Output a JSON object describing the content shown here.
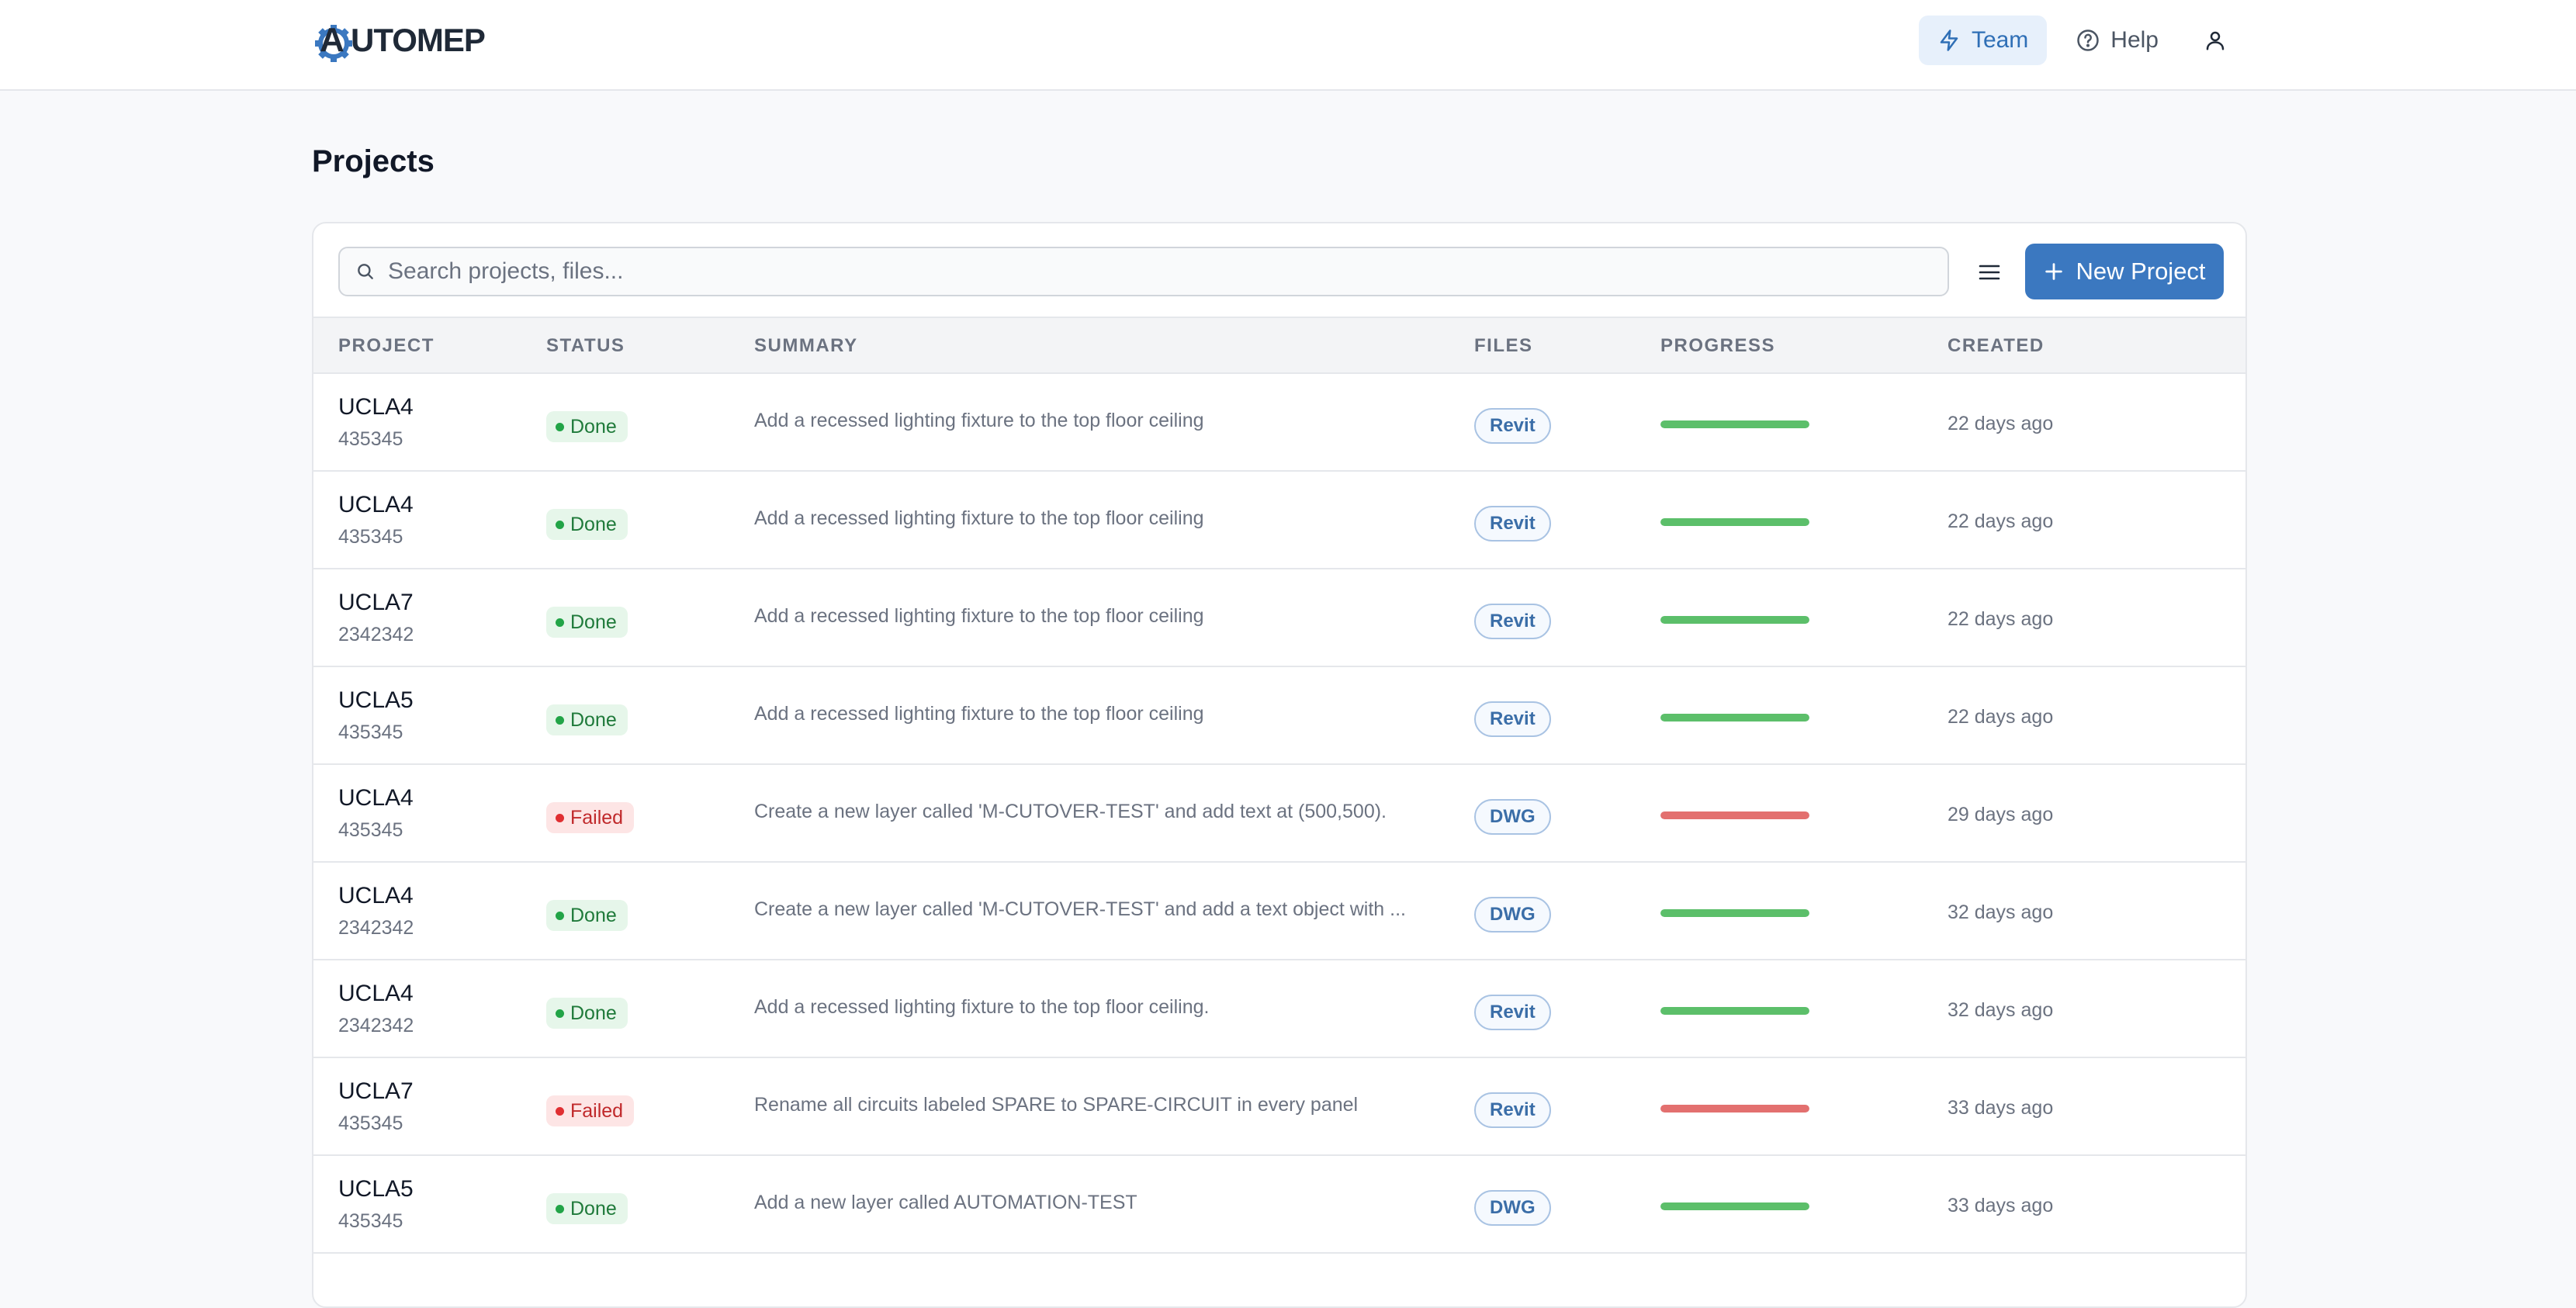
{
  "brand": {
    "name": "UTOMEP",
    "initial": "A"
  },
  "nav": {
    "team_label": "Team",
    "help_label": "Help"
  },
  "page": {
    "title": "Projects"
  },
  "toolbar": {
    "search_placeholder": "Search projects, files...",
    "new_project_label": "New Project"
  },
  "table": {
    "columns": [
      "PROJECT",
      "STATUS",
      "SUMMARY",
      "FILES",
      "PROGRESS",
      "CREATED"
    ],
    "rows": [
      {
        "project": "UCLA4",
        "id": "435345",
        "status": "Done",
        "status_kind": "done",
        "summary": "Add a recessed lighting fixture to the top floor ceiling",
        "file": "Revit",
        "progress": 1.0,
        "created": "22 days ago"
      },
      {
        "project": "UCLA4",
        "id": "435345",
        "status": "Done",
        "status_kind": "done",
        "summary": "Add a recessed lighting fixture to the top floor ceiling",
        "file": "Revit",
        "progress": 1.0,
        "created": "22 days ago"
      },
      {
        "project": "UCLA7",
        "id": "2342342",
        "status": "Done",
        "status_kind": "done",
        "summary": "Add a recessed lighting fixture to the top floor ceiling",
        "file": "Revit",
        "progress": 1.0,
        "created": "22 days ago"
      },
      {
        "project": "UCLA5",
        "id": "435345",
        "status": "Done",
        "status_kind": "done",
        "summary": "Add a recessed lighting fixture to the top floor ceiling",
        "file": "Revit",
        "progress": 1.0,
        "created": "22 days ago"
      },
      {
        "project": "UCLA4",
        "id": "435345",
        "status": "Failed",
        "status_kind": "failed",
        "summary": "Create a new layer called 'M-CUTOVER-TEST' and add text at (500,500).",
        "file": "DWG",
        "progress": 1.0,
        "created": "29 days ago"
      },
      {
        "project": "UCLA4",
        "id": "2342342",
        "status": "Done",
        "status_kind": "done",
        "summary": "Create a new layer called 'M-CUTOVER-TEST' and add a text object with ...",
        "file": "DWG",
        "progress": 1.0,
        "created": "32 days ago"
      },
      {
        "project": "UCLA4",
        "id": "2342342",
        "status": "Done",
        "status_kind": "done",
        "summary": "Add a recessed lighting fixture to the top floor ceiling.",
        "file": "Revit",
        "progress": 1.0,
        "created": "32 days ago"
      },
      {
        "project": "UCLA7",
        "id": "435345",
        "status": "Failed",
        "status_kind": "failed",
        "summary": "Rename all circuits labeled SPARE to SPARE-CIRCUIT in every panel",
        "file": "Revit",
        "progress": 1.0,
        "created": "33 days ago"
      },
      {
        "project": "UCLA5",
        "id": "435345",
        "status": "Done",
        "status_kind": "done",
        "summary": "Add a new layer called AUTOMATION-TEST",
        "file": "DWG",
        "progress": 1.0,
        "created": "33 days ago"
      }
    ]
  },
  "colors": {
    "accent": "#3b78c0",
    "done": "#5cbf6a",
    "failed": "#e3706f"
  },
  "icons": {
    "team": "lightning-icon",
    "help": "question-circle-icon",
    "user": "user-icon",
    "search": "search-icon",
    "menu": "hamburger-menu-icon",
    "add": "plus-icon"
  }
}
